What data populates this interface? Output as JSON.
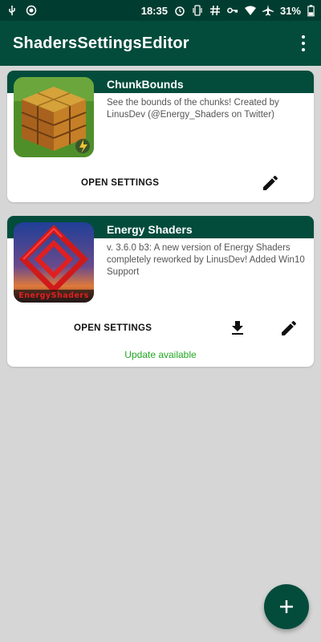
{
  "status_bar": {
    "time": "18:35",
    "battery": "31%"
  },
  "app_bar": {
    "title": "ShadersSettingsEditor"
  },
  "shaders": [
    {
      "name": "ChunkBounds",
      "description": "See the bounds of the chunks! Created by LinusDev (@Energy_Shaders on Twitter)",
      "open_label": "OPEN SETTINGS"
    },
    {
      "name": "Energy Shaders",
      "description": "v. 3.6.0 b3: A new version of Energy Shaders completely reworked by LinusDev! Added Win10 Support",
      "open_label": "OPEN SETTINGS",
      "update_label": "Update available",
      "thumb_text": "EnergyShaders"
    }
  ],
  "colors": {
    "primary": "#034c3c",
    "status_bar": "#003d30",
    "update": "#22aa22",
    "background": "#d6d6d6"
  },
  "icons": {
    "edit": "pencil-icon",
    "download": "download-icon",
    "fab": "plus-icon",
    "menu": "more-vert-icon"
  }
}
